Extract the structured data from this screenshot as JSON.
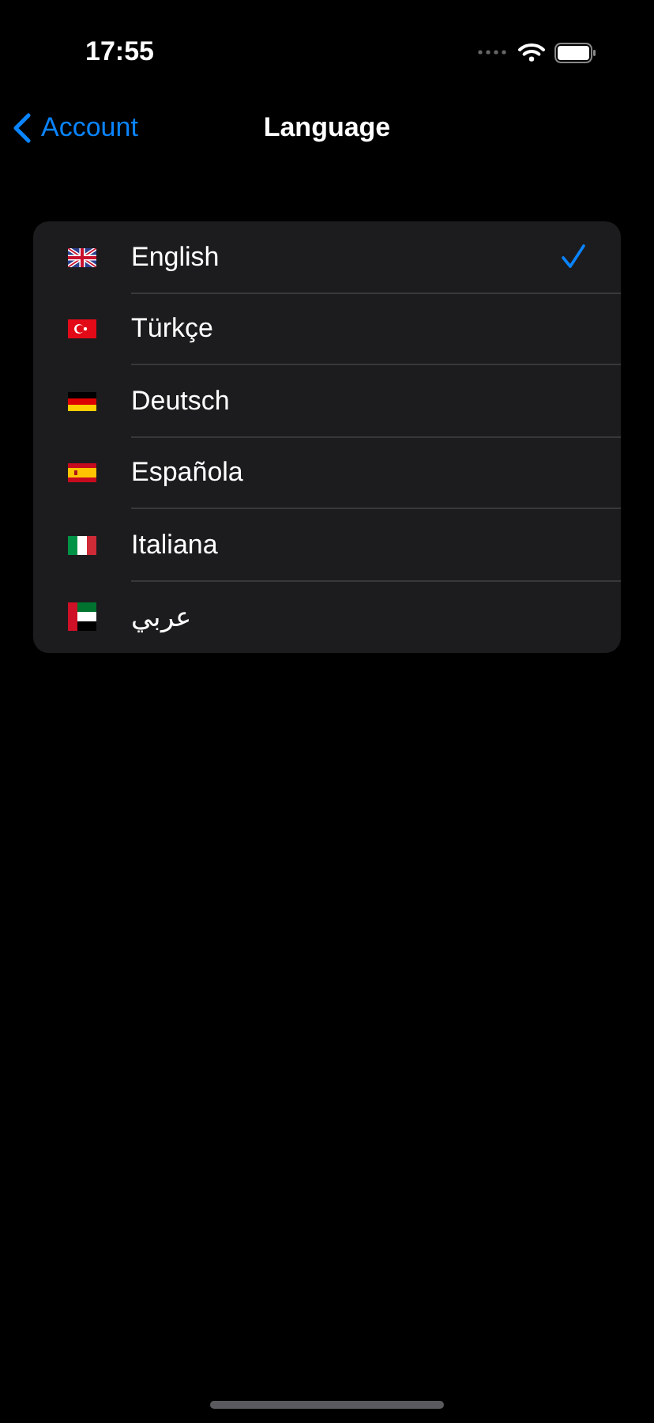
{
  "status_bar": {
    "time": "17:55"
  },
  "nav": {
    "back": "Account",
    "title": "Language"
  },
  "languages": [
    {
      "label": "English",
      "kind": "uk",
      "selected": true
    },
    {
      "label": "Türkçe",
      "kind": "tr",
      "selected": false
    },
    {
      "label": "Deutsch",
      "kind": "de",
      "selected": false
    },
    {
      "label": "Española",
      "kind": "es",
      "selected": false
    },
    {
      "label": "Italiana",
      "kind": "it",
      "selected": false
    },
    {
      "label": "عربي",
      "kind": "ae",
      "selected": false
    }
  ]
}
